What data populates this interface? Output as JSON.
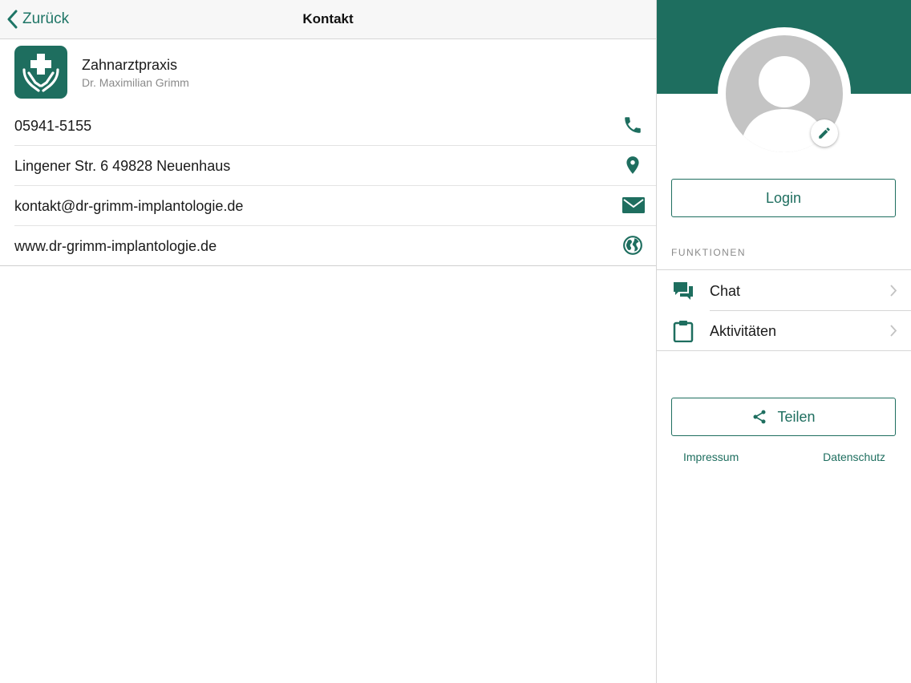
{
  "colors": {
    "accent": "#1e6e5f",
    "avatar_gray": "#c4c4c4",
    "secondary_text": "#8a8a8a"
  },
  "navbar": {
    "back_label": "Zurück",
    "title": "Kontakt"
  },
  "header": {
    "company": "Zahnarztpraxis",
    "doctor": "Dr. Maximilian Grimm",
    "icon": "medical-hands-icon"
  },
  "contacts": [
    {
      "text": "05941-5155",
      "icon": "phone-icon"
    },
    {
      "text": "Lingener Str. 6 49828 Neuenhaus",
      "icon": "location-pin-icon"
    },
    {
      "text": "kontakt@dr-grimm-implantologie.de",
      "icon": "mail-icon"
    },
    {
      "text": "www.dr-grimm-implantologie.de",
      "icon": "globe-icon"
    }
  ],
  "sidebar": {
    "login_label": "Login",
    "section_label": "FUNKTIONEN",
    "functions": [
      {
        "label": "Chat",
        "icon": "chat-icon"
      },
      {
        "label": "Aktivitäten",
        "icon": "clipboard-icon"
      }
    ],
    "share_label": "Teilen",
    "impressum_label": "Impressum",
    "datenschutz_label": "Datenschutz"
  }
}
